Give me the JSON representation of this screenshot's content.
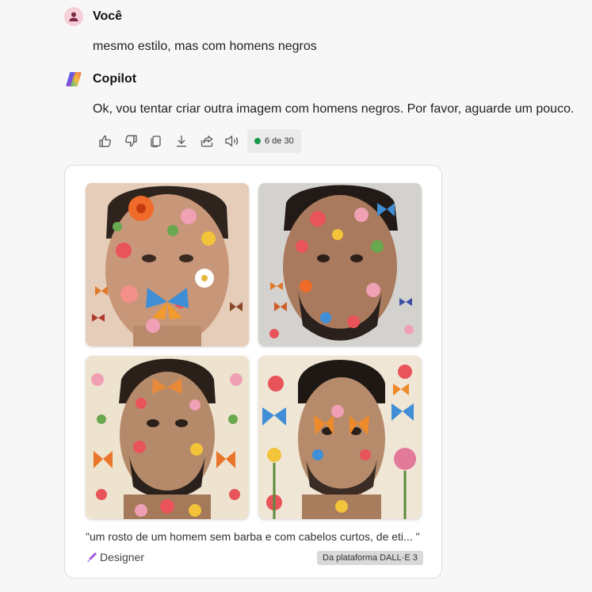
{
  "user_message": {
    "sender": "Você",
    "text": "mesmo estilo, mas com homens negros"
  },
  "bot_message": {
    "sender": "Copilot",
    "text": "Ok, vou tentar criar outra imagem com homens negros. Por favor, aguarde um pouco."
  },
  "actions": {
    "icons": [
      "thumbs-up-icon",
      "thumbs-down-icon",
      "copy-icon",
      "download-icon",
      "share-icon",
      "speaker-icon"
    ],
    "counter": "6 de 30",
    "counter_color": "#1a9a4b"
  },
  "image_card": {
    "images": [
      {
        "description": "Portrait of man with face covered in embroidered flowers and a blue butterfly"
      },
      {
        "description": "Portrait of bearded man with face covered in floral embroidery"
      },
      {
        "description": "Portrait of man with floral pattern face and orange butterflies background"
      },
      {
        "description": "Portrait of man with floral face, blue and orange butterflies background"
      }
    ],
    "caption": "\"um rosto de um homem sem barba e com cabelos curtos, de eti... \"",
    "designer_label": "Designer",
    "platform_badge": "Da plataforma DALL·E 3"
  }
}
